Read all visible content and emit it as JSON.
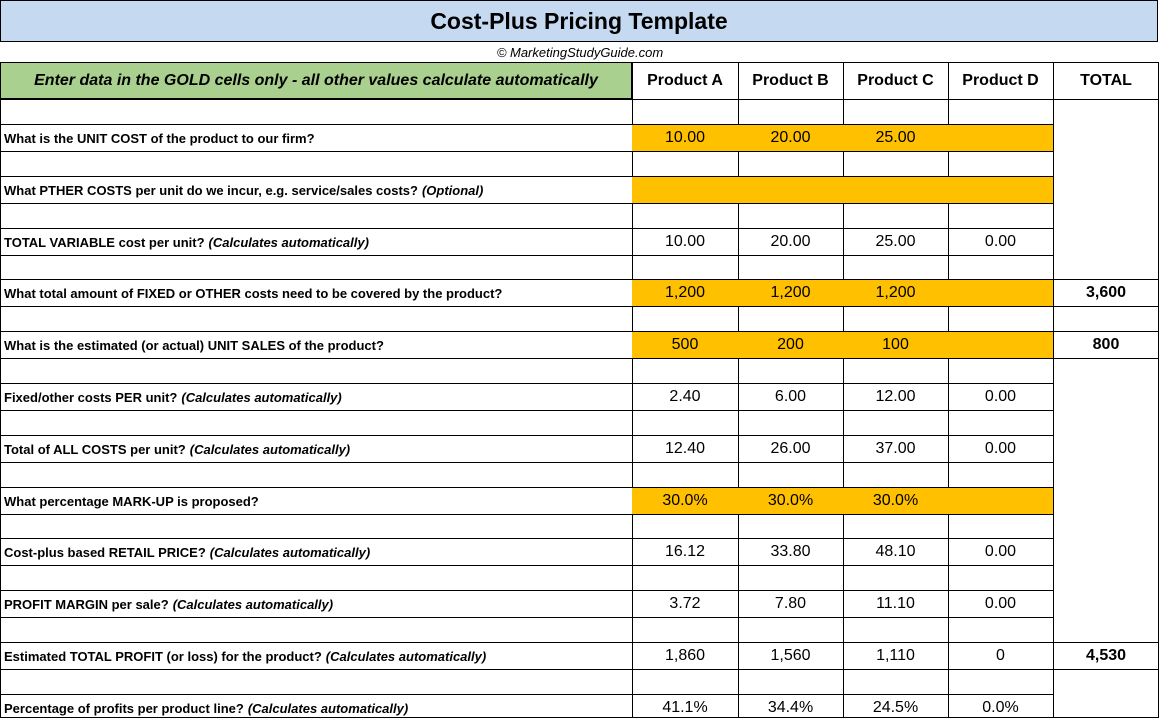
{
  "title": "Cost-Plus Pricing Template",
  "credit": "© MarketingStudyGuide.com",
  "instruction": "Enter data in the GOLD cells only - all other values calculate automatically",
  "columns": [
    "Product A",
    "Product B",
    "Product C",
    "Product D",
    "TOTAL"
  ],
  "colors": {
    "gold": "#ffc000",
    "title_bg": "#c5d9f1",
    "instruction_bg": "#a9d08e"
  },
  "rows": [
    {
      "label": "What is the UNIT COST of the product to our firm?",
      "note": "",
      "input": true,
      "values": [
        "10.00",
        "20.00",
        "25.00",
        ""
      ],
      "total": ""
    },
    {
      "label": "What PTHER COSTS per unit do we incur, e.g. service/sales costs?",
      "note": "(Optional)",
      "input": true,
      "values": [
        "",
        "",
        "",
        ""
      ],
      "total": ""
    },
    {
      "label": "TOTAL VARIABLE cost per unit?",
      "note": "(Calculates automatically)",
      "input": false,
      "values": [
        "10.00",
        "20.00",
        "25.00",
        "0.00"
      ],
      "total": ""
    },
    {
      "label": "What total amount of FIXED or OTHER costs need to be covered by the product?",
      "note": "",
      "input": true,
      "values": [
        "1,200",
        "1,200",
        "1,200",
        ""
      ],
      "total": "3,600"
    },
    {
      "label": "What is the estimated (or actual) UNIT SALES of the product?",
      "note": "",
      "input": true,
      "values": [
        "500",
        "200",
        "100",
        ""
      ],
      "total": "800"
    },
    {
      "label": "Fixed/other costs PER unit?",
      "note": "(Calculates automatically)",
      "input": false,
      "values": [
        "2.40",
        "6.00",
        "12.00",
        "0.00"
      ],
      "total": ""
    },
    {
      "label": "Total of ALL COSTS per unit?",
      "note": "(Calculates automatically)",
      "input": false,
      "values": [
        "12.40",
        "26.00",
        "37.00",
        "0.00"
      ],
      "total": ""
    },
    {
      "label": "What percentage MARK-UP is proposed?",
      "note": "",
      "input": true,
      "values": [
        "30.0%",
        "30.0%",
        "30.0%",
        ""
      ],
      "total": ""
    },
    {
      "label": "Cost-plus based RETAIL PRICE?",
      "note": "(Calculates automatically)",
      "input": false,
      "values": [
        "16.12",
        "33.80",
        "48.10",
        "0.00"
      ],
      "total": ""
    },
    {
      "label": "PROFIT MARGIN per sale?",
      "note": "(Calculates automatically)",
      "input": false,
      "values": [
        "3.72",
        "7.80",
        "11.10",
        "0.00"
      ],
      "total": ""
    },
    {
      "label": "Estimated TOTAL PROFIT (or loss) for the product?",
      "note": "(Calculates automatically)",
      "input": false,
      "values": [
        "1,860",
        "1,560",
        "1,110",
        "0"
      ],
      "total": "4,530"
    },
    {
      "label": "Percentage of profits per product line?",
      "note": "(Calculates automatically)",
      "input": false,
      "values": [
        "41.1%",
        "34.4%",
        "24.5%",
        "0.0%"
      ],
      "total": ""
    }
  ]
}
